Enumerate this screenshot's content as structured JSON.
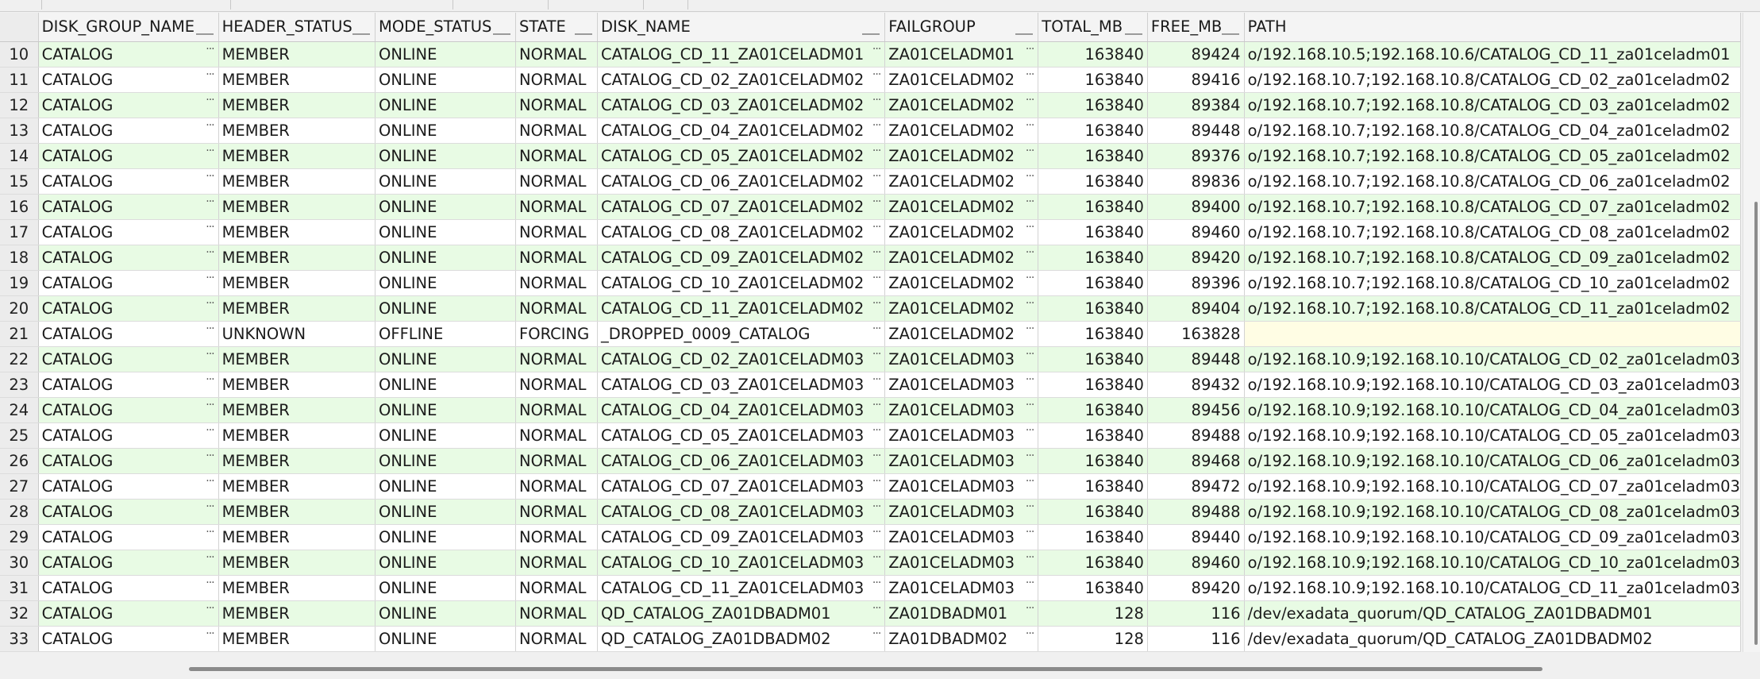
{
  "columns": [
    "DISK_GROUP_NAME",
    "HEADER_STATUS",
    "MODE_STATUS",
    "STATE",
    "DISK_NAME",
    "FAILGROUP",
    "TOTAL_MB",
    "FREE_MB",
    "PATH"
  ],
  "rows": [
    {
      "n": "10",
      "dg": "CATALOG",
      "hs": "MEMBER",
      "ms": "ONLINE",
      "st": "NORMAL",
      "dn": "CATALOG_CD_11_ZA01CELADM01",
      "fg": "ZA01CELADM01",
      "tot": "163840",
      "free": "89424",
      "path": "o/192.168.10.5;192.168.10.6/CATALOG_CD_11_za01celadm01"
    },
    {
      "n": "11",
      "dg": "CATALOG",
      "hs": "MEMBER",
      "ms": "ONLINE",
      "st": "NORMAL",
      "dn": "CATALOG_CD_02_ZA01CELADM02",
      "fg": "ZA01CELADM02",
      "tot": "163840",
      "free": "89416",
      "path": "o/192.168.10.7;192.168.10.8/CATALOG_CD_02_za01celadm02"
    },
    {
      "n": "12",
      "dg": "CATALOG",
      "hs": "MEMBER",
      "ms": "ONLINE",
      "st": "NORMAL",
      "dn": "CATALOG_CD_03_ZA01CELADM02",
      "fg": "ZA01CELADM02",
      "tot": "163840",
      "free": "89384",
      "path": "o/192.168.10.7;192.168.10.8/CATALOG_CD_03_za01celadm02"
    },
    {
      "n": "13",
      "dg": "CATALOG",
      "hs": "MEMBER",
      "ms": "ONLINE",
      "st": "NORMAL",
      "dn": "CATALOG_CD_04_ZA01CELADM02",
      "fg": "ZA01CELADM02",
      "tot": "163840",
      "free": "89448",
      "path": "o/192.168.10.7;192.168.10.8/CATALOG_CD_04_za01celadm02"
    },
    {
      "n": "14",
      "dg": "CATALOG",
      "hs": "MEMBER",
      "ms": "ONLINE",
      "st": "NORMAL",
      "dn": "CATALOG_CD_05_ZA01CELADM02",
      "fg": "ZA01CELADM02",
      "tot": "163840",
      "free": "89376",
      "path": "o/192.168.10.7;192.168.10.8/CATALOG_CD_05_za01celadm02"
    },
    {
      "n": "15",
      "dg": "CATALOG",
      "hs": "MEMBER",
      "ms": "ONLINE",
      "st": "NORMAL",
      "dn": "CATALOG_CD_06_ZA01CELADM02",
      "fg": "ZA01CELADM02",
      "tot": "163840",
      "free": "89836",
      "path": "o/192.168.10.7;192.168.10.8/CATALOG_CD_06_za01celadm02"
    },
    {
      "n": "16",
      "dg": "CATALOG",
      "hs": "MEMBER",
      "ms": "ONLINE",
      "st": "NORMAL",
      "dn": "CATALOG_CD_07_ZA01CELADM02",
      "fg": "ZA01CELADM02",
      "tot": "163840",
      "free": "89400",
      "path": "o/192.168.10.7;192.168.10.8/CATALOG_CD_07_za01celadm02"
    },
    {
      "n": "17",
      "dg": "CATALOG",
      "hs": "MEMBER",
      "ms": "ONLINE",
      "st": "NORMAL",
      "dn": "CATALOG_CD_08_ZA01CELADM02",
      "fg": "ZA01CELADM02",
      "tot": "163840",
      "free": "89460",
      "path": "o/192.168.10.7;192.168.10.8/CATALOG_CD_08_za01celadm02"
    },
    {
      "n": "18",
      "dg": "CATALOG",
      "hs": "MEMBER",
      "ms": "ONLINE",
      "st": "NORMAL",
      "dn": "CATALOG_CD_09_ZA01CELADM02",
      "fg": "ZA01CELADM02",
      "tot": "163840",
      "free": "89420",
      "path": "o/192.168.10.7;192.168.10.8/CATALOG_CD_09_za01celadm02"
    },
    {
      "n": "19",
      "dg": "CATALOG",
      "hs": "MEMBER",
      "ms": "ONLINE",
      "st": "NORMAL",
      "dn": "CATALOG_CD_10_ZA01CELADM02",
      "fg": "ZA01CELADM02",
      "tot": "163840",
      "free": "89396",
      "path": "o/192.168.10.7;192.168.10.8/CATALOG_CD_10_za01celadm02"
    },
    {
      "n": "20",
      "dg": "CATALOG",
      "hs": "MEMBER",
      "ms": "ONLINE",
      "st": "NORMAL",
      "dn": "CATALOG_CD_11_ZA01CELADM02",
      "fg": "ZA01CELADM02",
      "tot": "163840",
      "free": "89404",
      "path": "o/192.168.10.7;192.168.10.8/CATALOG_CD_11_za01celadm02"
    },
    {
      "n": "21",
      "dg": "CATALOG",
      "hs": "UNKNOWN",
      "ms": "OFFLINE",
      "st": "FORCING",
      "dn": "_DROPPED_0009_CATALOG",
      "fg": "ZA01CELADM02",
      "tot": "163840",
      "free": "163828",
      "path": ""
    },
    {
      "n": "22",
      "dg": "CATALOG",
      "hs": "MEMBER",
      "ms": "ONLINE",
      "st": "NORMAL",
      "dn": "CATALOG_CD_02_ZA01CELADM03",
      "fg": "ZA01CELADM03",
      "tot": "163840",
      "free": "89448",
      "path": "o/192.168.10.9;192.168.10.10/CATALOG_CD_02_za01celadm03"
    },
    {
      "n": "23",
      "dg": "CATALOG",
      "hs": "MEMBER",
      "ms": "ONLINE",
      "st": "NORMAL",
      "dn": "CATALOG_CD_03_ZA01CELADM03",
      "fg": "ZA01CELADM03",
      "tot": "163840",
      "free": "89432",
      "path": "o/192.168.10.9;192.168.10.10/CATALOG_CD_03_za01celadm03"
    },
    {
      "n": "24",
      "dg": "CATALOG",
      "hs": "MEMBER",
      "ms": "ONLINE",
      "st": "NORMAL",
      "dn": "CATALOG_CD_04_ZA01CELADM03",
      "fg": "ZA01CELADM03",
      "tot": "163840",
      "free": "89456",
      "path": "o/192.168.10.9;192.168.10.10/CATALOG_CD_04_za01celadm03"
    },
    {
      "n": "25",
      "dg": "CATALOG",
      "hs": "MEMBER",
      "ms": "ONLINE",
      "st": "NORMAL",
      "dn": "CATALOG_CD_05_ZA01CELADM03",
      "fg": "ZA01CELADM03",
      "tot": "163840",
      "free": "89488",
      "path": "o/192.168.10.9;192.168.10.10/CATALOG_CD_05_za01celadm03"
    },
    {
      "n": "26",
      "dg": "CATALOG",
      "hs": "MEMBER",
      "ms": "ONLINE",
      "st": "NORMAL",
      "dn": "CATALOG_CD_06_ZA01CELADM03",
      "fg": "ZA01CELADM03",
      "tot": "163840",
      "free": "89468",
      "path": "o/192.168.10.9;192.168.10.10/CATALOG_CD_06_za01celadm03"
    },
    {
      "n": "27",
      "dg": "CATALOG",
      "hs": "MEMBER",
      "ms": "ONLINE",
      "st": "NORMAL",
      "dn": "CATALOG_CD_07_ZA01CELADM03",
      "fg": "ZA01CELADM03",
      "tot": "163840",
      "free": "89472",
      "path": "o/192.168.10.9;192.168.10.10/CATALOG_CD_07_za01celadm03"
    },
    {
      "n": "28",
      "dg": "CATALOG",
      "hs": "MEMBER",
      "ms": "ONLINE",
      "st": "NORMAL",
      "dn": "CATALOG_CD_08_ZA01CELADM03",
      "fg": "ZA01CELADM03",
      "tot": "163840",
      "free": "89488",
      "path": "o/192.168.10.9;192.168.10.10/CATALOG_CD_08_za01celadm03"
    },
    {
      "n": "29",
      "dg": "CATALOG",
      "hs": "MEMBER",
      "ms": "ONLINE",
      "st": "NORMAL",
      "dn": "CATALOG_CD_09_ZA01CELADM03",
      "fg": "ZA01CELADM03",
      "tot": "163840",
      "free": "89440",
      "path": "o/192.168.10.9;192.168.10.10/CATALOG_CD_09_za01celadm03"
    },
    {
      "n": "30",
      "dg": "CATALOG",
      "hs": "MEMBER",
      "ms": "ONLINE",
      "st": "NORMAL",
      "dn": "CATALOG_CD_10_ZA01CELADM03",
      "fg": "ZA01CELADM03",
      "tot": "163840",
      "free": "89460",
      "path": "o/192.168.10.9;192.168.10.10/CATALOG_CD_10_za01celadm03"
    },
    {
      "n": "31",
      "dg": "CATALOG",
      "hs": "MEMBER",
      "ms": "ONLINE",
      "st": "NORMAL",
      "dn": "CATALOG_CD_11_ZA01CELADM03",
      "fg": "ZA01CELADM03",
      "tot": "163840",
      "free": "89420",
      "path": "o/192.168.10.9;192.168.10.10/CATALOG_CD_11_za01celadm03"
    },
    {
      "n": "32",
      "dg": "CATALOG",
      "hs": "MEMBER",
      "ms": "ONLINE",
      "st": "NORMAL",
      "dn": "QD_CATALOG_ZA01DBADM01",
      "fg": "ZA01DBADM01",
      "tot": "128",
      "free": "116",
      "path": "/dev/exadata_quorum/QD_CATALOG_ZA01DBADM01"
    },
    {
      "n": "33",
      "dg": "CATALOG",
      "hs": "MEMBER",
      "ms": "ONLINE",
      "st": "NORMAL",
      "dn": "QD_CATALOG_ZA01DBADM02",
      "fg": "ZA01DBADM02",
      "tot": "128",
      "free": "116",
      "path": "/dev/exadata_quorum/QD_CATALOG_ZA01DBADM02"
    }
  ],
  "ellipsis_glyph": "···",
  "colors": {
    "alt_row": "#e8fbe4",
    "null_cell": "#fffde4",
    "header": "#f4f4f4"
  }
}
